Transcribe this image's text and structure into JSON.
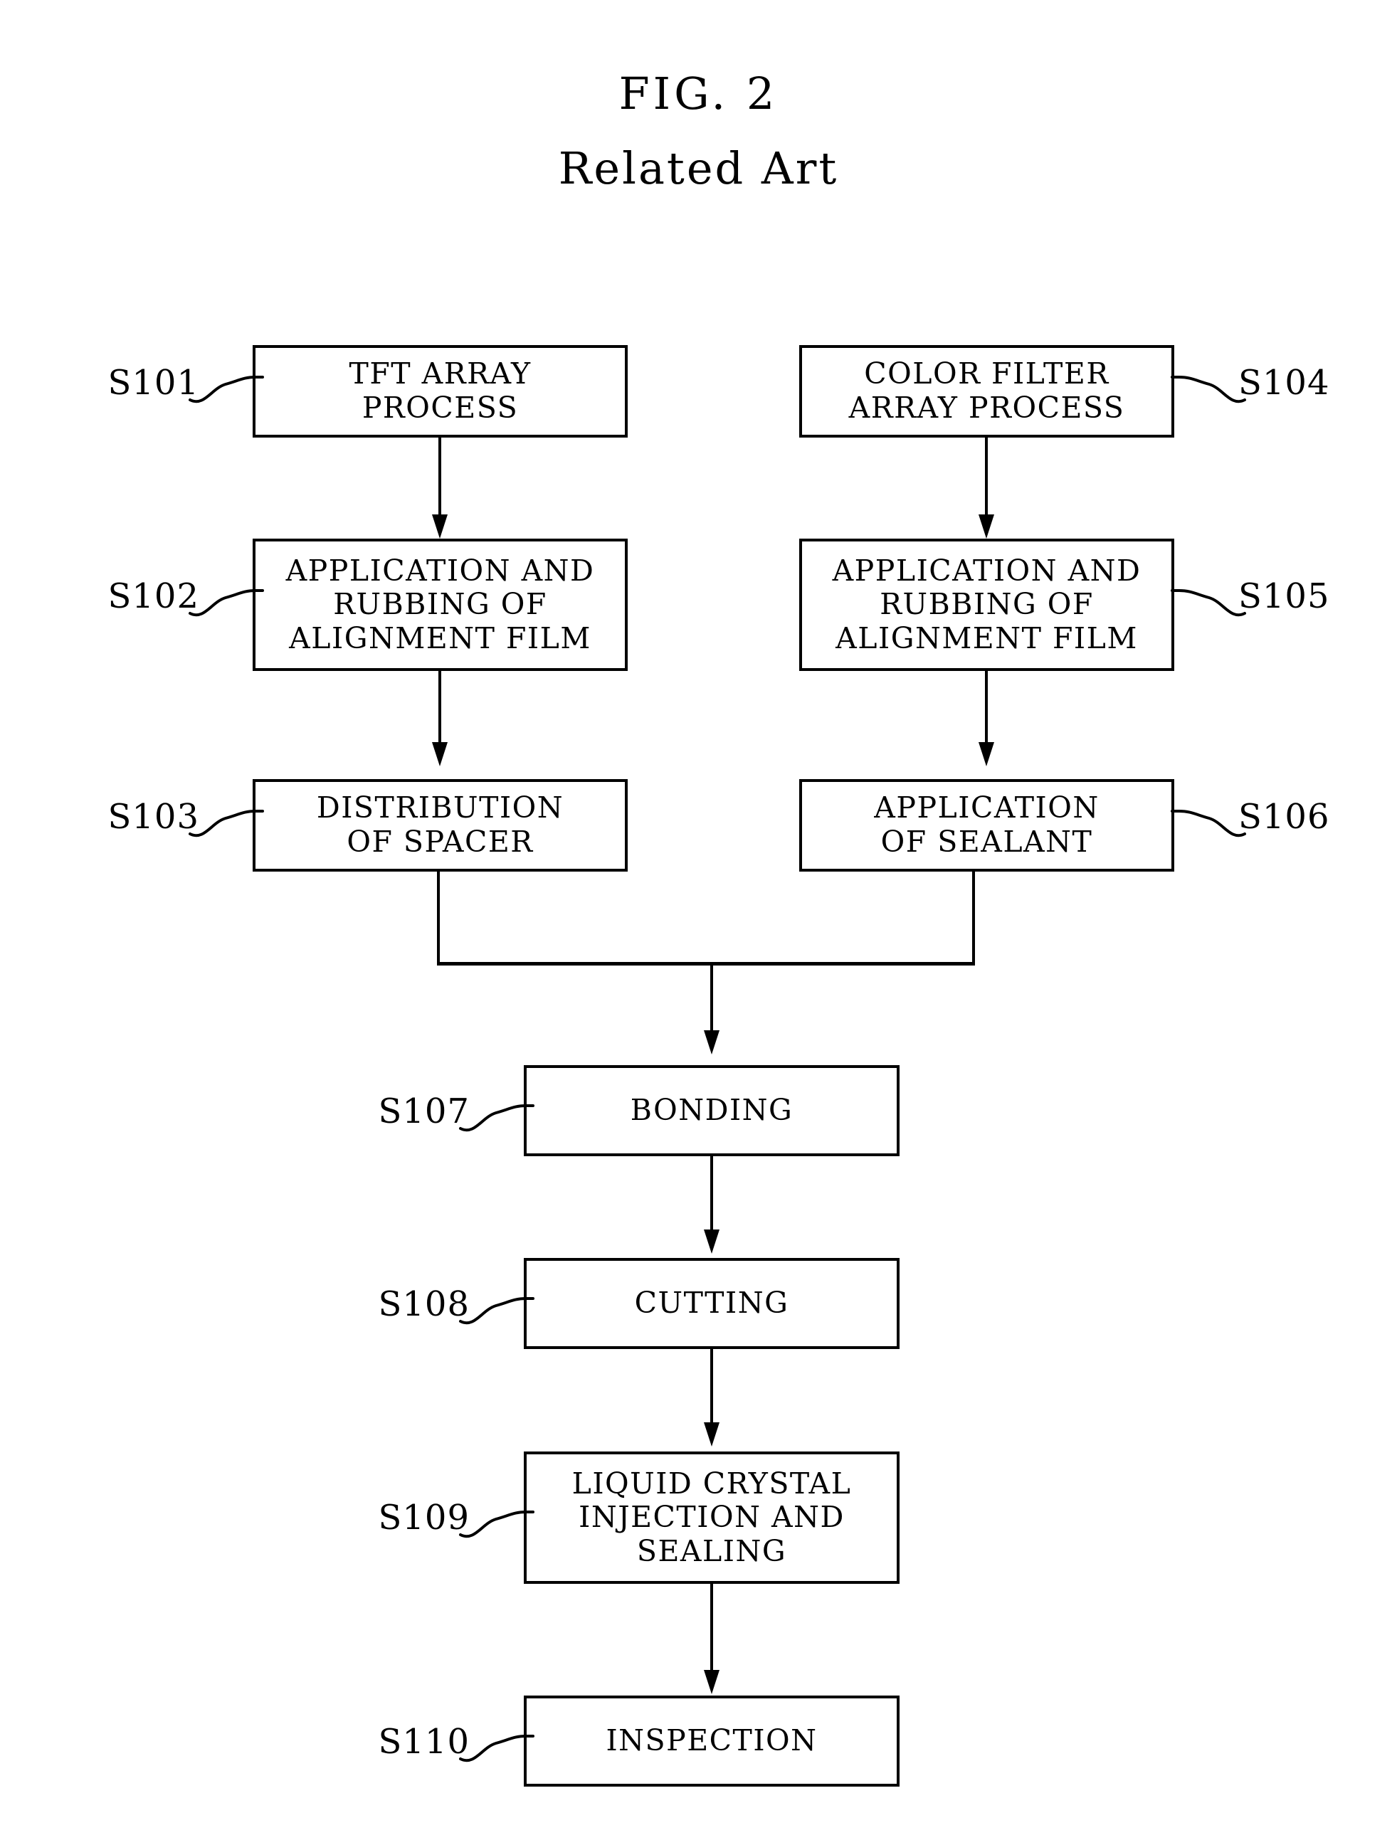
{
  "figure": {
    "title": "FIG. 2",
    "subtitle": "Related Art",
    "type": "process-flowchart",
    "subject": "Liquid crystal display panel fabrication process (related art)"
  },
  "colors": {
    "ink": "#000000",
    "paper": "#ffffff"
  },
  "nodes": [
    {
      "id": "S101",
      "ref": "S101",
      "ref_side": "left",
      "label": "TFT ARRAY\nPROCESS",
      "column": "left",
      "row": 1
    },
    {
      "id": "S102",
      "ref": "S102",
      "ref_side": "left",
      "label": "APPLICATION AND\nRUBBING OF\nALIGNMENT FILM",
      "column": "left",
      "row": 2
    },
    {
      "id": "S103",
      "ref": "S103",
      "ref_side": "left",
      "label": "DISTRIBUTION\nOF SPACER",
      "column": "left",
      "row": 3
    },
    {
      "id": "S104",
      "ref": "S104",
      "ref_side": "right",
      "label": "COLOR FILTER\nARRAY PROCESS",
      "column": "right",
      "row": 1
    },
    {
      "id": "S105",
      "ref": "S105",
      "ref_side": "right",
      "label": "APPLICATION AND\nRUBBING OF\nALIGNMENT FILM",
      "column": "right",
      "row": 2
    },
    {
      "id": "S106",
      "ref": "S106",
      "ref_side": "right",
      "label": "APPLICATION\nOF SEALANT",
      "column": "right",
      "row": 3
    },
    {
      "id": "S107",
      "ref": "S107",
      "ref_side": "left",
      "label": "BONDING",
      "column": "center",
      "row": 4
    },
    {
      "id": "S108",
      "ref": "S108",
      "ref_side": "left",
      "label": "CUTTING",
      "column": "center",
      "row": 5
    },
    {
      "id": "S109",
      "ref": "S109",
      "ref_side": "left",
      "label": "LIQUID CRYSTAL\nINJECTION AND\nSEALING",
      "column": "center",
      "row": 6
    },
    {
      "id": "S110",
      "ref": "S110",
      "ref_side": "left",
      "label": "INSPECTION",
      "column": "center",
      "row": 7
    }
  ],
  "edges": [
    {
      "from": "S101",
      "to": "S102",
      "kind": "arrow"
    },
    {
      "from": "S102",
      "to": "S103",
      "kind": "arrow"
    },
    {
      "from": "S104",
      "to": "S105",
      "kind": "arrow"
    },
    {
      "from": "S105",
      "to": "S106",
      "kind": "arrow"
    },
    {
      "from": "S103",
      "to": "merge",
      "kind": "line"
    },
    {
      "from": "S106",
      "to": "merge",
      "kind": "line"
    },
    {
      "from": "merge",
      "to": "S107",
      "kind": "arrow"
    },
    {
      "from": "S107",
      "to": "S108",
      "kind": "arrow"
    },
    {
      "from": "S108",
      "to": "S109",
      "kind": "arrow"
    },
    {
      "from": "S109",
      "to": "S110",
      "kind": "arrow"
    }
  ]
}
